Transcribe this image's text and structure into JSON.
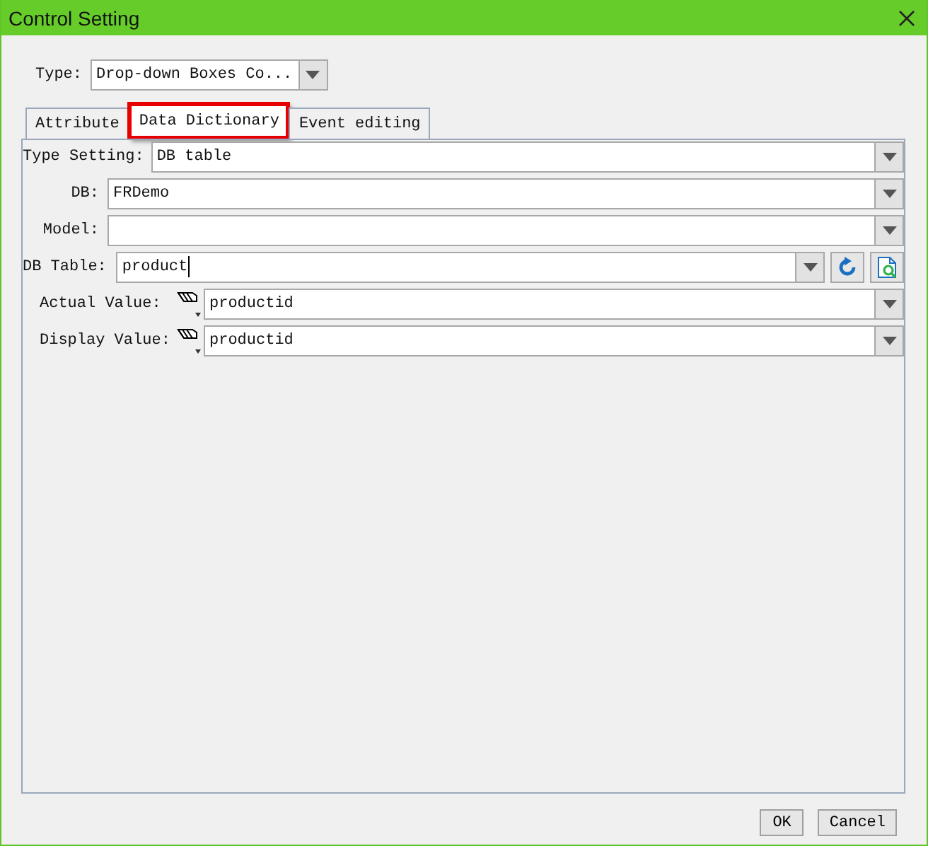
{
  "window": {
    "title": "Control Setting"
  },
  "type_field": {
    "label": "Type:",
    "value": "Drop-down Boxes Co..."
  },
  "tabs": [
    {
      "label": "Attribute",
      "selected": false,
      "highlighted": false
    },
    {
      "label": "Data Dictionary",
      "selected": true,
      "highlighted": true
    },
    {
      "label": "Event editing",
      "selected": false,
      "highlighted": false
    }
  ],
  "rows": [
    {
      "kind": "plain",
      "label": "Type Setting:",
      "value": "DB table"
    },
    {
      "kind": "short",
      "label": "DB:",
      "value": "FRDemo"
    },
    {
      "kind": "short",
      "label": "Model:"
    },
    {
      "kind": "tools",
      "label": "DB Table:",
      "value": "product",
      "focused": true
    },
    {
      "kind": "column",
      "label": "Actual Value:",
      "value": "productid"
    },
    {
      "kind": "column",
      "label": "Display Value:",
      "value": "productid"
    }
  ],
  "buttons": [
    "OK",
    "Cancel"
  ]
}
